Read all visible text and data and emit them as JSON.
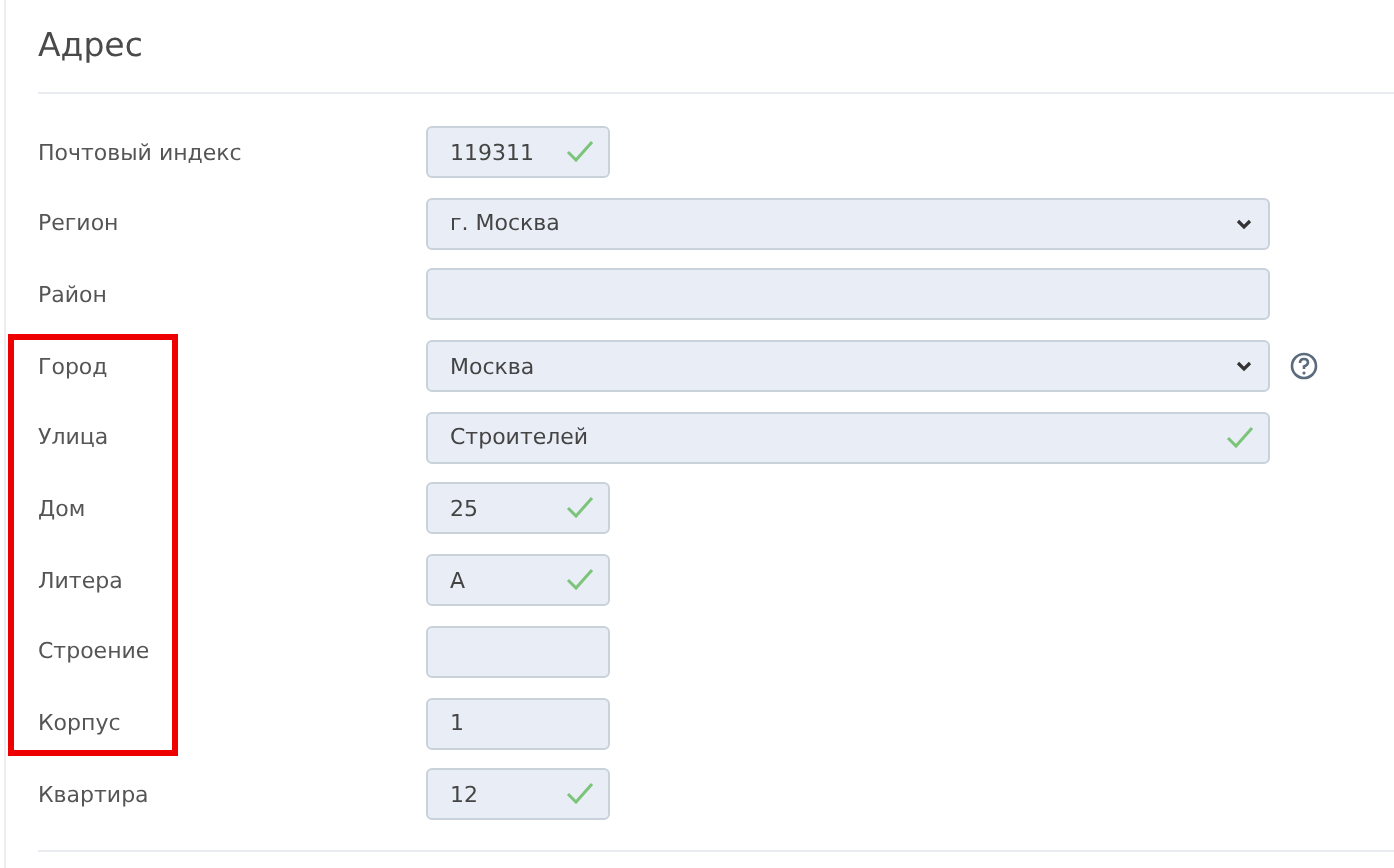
{
  "section": {
    "title": "Адрес"
  },
  "rows": [
    {
      "label": "Почтовый индекс",
      "kind": "narrow",
      "value": "119311",
      "valid": true,
      "help": false,
      "highlighted": false
    },
    {
      "label": "Регион",
      "kind": "select",
      "value": "г. Москва",
      "valid": false,
      "help": false,
      "highlighted": false
    },
    {
      "label": "Район",
      "kind": "wide",
      "valid": false,
      "help": false,
      "highlighted": false
    },
    {
      "label": "Город",
      "kind": "select",
      "value": "Москва",
      "valid": false,
      "help": true,
      "highlighted": true
    },
    {
      "label": "Улица",
      "kind": "wide",
      "value": "Строителей",
      "valid": true,
      "help": false,
      "highlighted": true
    },
    {
      "label": "Дом",
      "kind": "narrow",
      "value": "25",
      "valid": true,
      "help": false,
      "highlighted": true
    },
    {
      "label": "Литера",
      "kind": "narrow",
      "value": "А",
      "valid": true,
      "help": false,
      "highlighted": true
    },
    {
      "label": "Строение",
      "kind": "narrow",
      "valid": false,
      "help": false,
      "highlighted": true
    },
    {
      "label": "Корпус",
      "kind": "narrow",
      "value": "1",
      "valid": false,
      "help": false,
      "highlighted": true
    },
    {
      "label": "Квартира",
      "kind": "narrow",
      "value": "12",
      "valid": true,
      "help": false,
      "highlighted": false
    }
  ]
}
